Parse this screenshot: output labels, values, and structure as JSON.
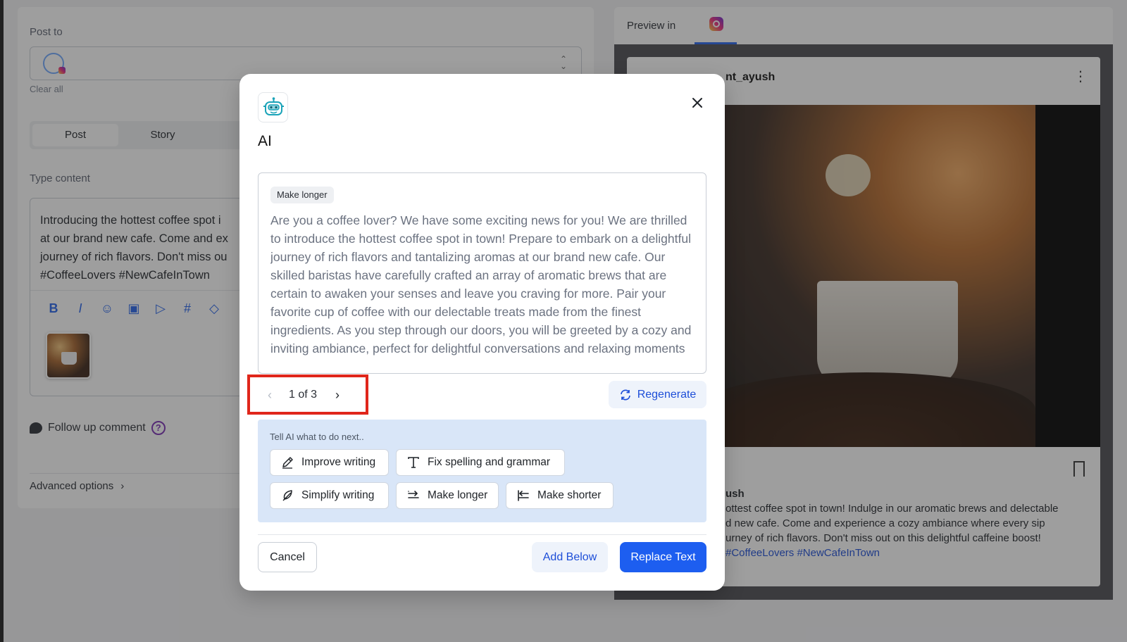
{
  "composer": {
    "post_to_label": "Post to",
    "clear_all": "Clear all",
    "tabs": [
      {
        "label": "Post"
      },
      {
        "label": "Story"
      }
    ],
    "type_content_label": "Type content",
    "content_text": "Introducing the hottest coffee spot i\nat our brand new cafe. Come and ex\njourney of rich flavors. Don't miss ou\n#CoffeeLovers #NewCafeInTown",
    "follow_up_label": "Follow up comment",
    "follow_up_help": "?",
    "advanced_label": "Advanced options"
  },
  "preview": {
    "label": "Preview in",
    "username": "nt_ayush",
    "caption_user": "ush",
    "caption_lines": [
      "ottest coffee spot in town! Indulge in our aromatic brews and delectable",
      "d new cafe. Come and experience a cozy ambiance where every sip",
      "urney of rich flavors. Don't miss out on this delightful caffeine boost!"
    ],
    "caption_tags": "#CoffeeLovers #NewCafeInTown"
  },
  "modal": {
    "title": "AI",
    "result_chip": "Make longer",
    "result_text": "Are you a coffee lover? We have some exciting news for you! We are thrilled to introduce the hottest coffee spot in town! Prepare to embark on a delightful journey of rich flavors and tantalizing aromas at our brand new cafe. Our skilled baristas have carefully crafted an array of aromatic brews that are certain to awaken your senses and leave you craving for more. Pair your favorite cup of coffee with our delectable treats made from the finest ingredients. As you step through our doors, you will be greeted by a cozy and inviting ambiance, perfect for delightful conversations and relaxing moments of solitude. Experience it today!",
    "pager": {
      "current": 1,
      "total": 3,
      "text": "1 of 3"
    },
    "regenerate_label": "Regenerate",
    "suggest_prompt": "Tell AI what to do next..",
    "actions": {
      "improve": "Improve writing",
      "fix": "Fix spelling and grammar",
      "simplify": "Simplify writing",
      "longer": "Make longer",
      "shorter": "Make shorter"
    },
    "cancel_label": "Cancel",
    "add_below_label": "Add Below",
    "replace_label": "Replace Text"
  },
  "colors": {
    "primary": "#1d5ef0",
    "highlight_border": "#e0261b",
    "suggest_bg": "#d9e6f8"
  },
  "icons": [
    "robot-icon",
    "close-icon",
    "chevron-left-icon",
    "chevron-right-icon",
    "refresh-icon",
    "pen-icon",
    "text-icon",
    "feather-icon",
    "arrow-expand-icon",
    "arrow-collapse-icon",
    "instagram-icon",
    "bookmark-icon"
  ]
}
